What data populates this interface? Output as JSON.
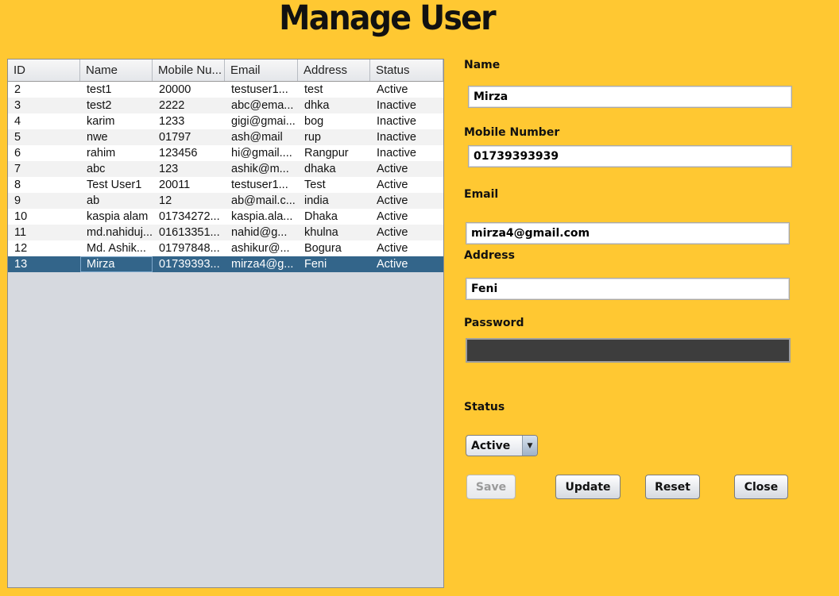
{
  "app": {
    "title": "Manage User"
  },
  "table": {
    "columns": [
      "ID",
      "Name",
      "Mobile Nu...",
      "Email",
      "Address",
      "Status"
    ],
    "rows": [
      [
        "2",
        "test1",
        "20000",
        "testuser1...",
        "test",
        "Active"
      ],
      [
        "3",
        "test2",
        "2222",
        "abc@ema...",
        "dhka",
        "Inactive"
      ],
      [
        "4",
        "karim",
        "1233",
        "gigi@gmai...",
        "bog",
        "Inactive"
      ],
      [
        "5",
        "nwe",
        "01797",
        "ash@mail",
        "rup",
        "Inactive"
      ],
      [
        "6",
        "rahim",
        "123456",
        "hi@gmail....",
        "Rangpur",
        "Inactive"
      ],
      [
        "7",
        "abc",
        "123",
        "ashik@m...",
        "dhaka",
        "Active"
      ],
      [
        "8",
        "Test User1",
        "20011",
        "testuser1...",
        "Test",
        "Active"
      ],
      [
        "9",
        "ab",
        "12",
        "ab@mail.c...",
        "india",
        "Active"
      ],
      [
        "10",
        "kaspia alam",
        "01734272...",
        "kaspia.ala...",
        "Dhaka",
        "Active"
      ],
      [
        "11",
        "md.nahiduj...",
        "01613351...",
        "nahid@g...",
        "khulna",
        "Active"
      ],
      [
        "12",
        "Md. Ashik...",
        "01797848...",
        "ashikur@...",
        "Bogura",
        "Active"
      ],
      [
        "13",
        "Mirza",
        "01739393...",
        "mirza4@g...",
        "Feni",
        "Active"
      ]
    ],
    "selected_row": 11
  },
  "form": {
    "name_label": "Name",
    "name_value": "Mirza",
    "mobile_label": "Mobile Number",
    "mobile_value": "01739393939",
    "email_label": "Email",
    "email_value": "mirza4@gmail.com",
    "address_label": "Address",
    "address_value": "Feni",
    "password_label": "Password",
    "password_value": "",
    "status_label": "Status",
    "status_value": "Active"
  },
  "buttons": {
    "save": "Save",
    "update": "Update",
    "reset": "Reset",
    "close": "Close"
  },
  "colors": {
    "background": "#ffc832",
    "selection": "#33658a",
    "password_field": "#3d3d3d"
  },
  "icons": {
    "dropdown": "chevron-down-icon"
  }
}
